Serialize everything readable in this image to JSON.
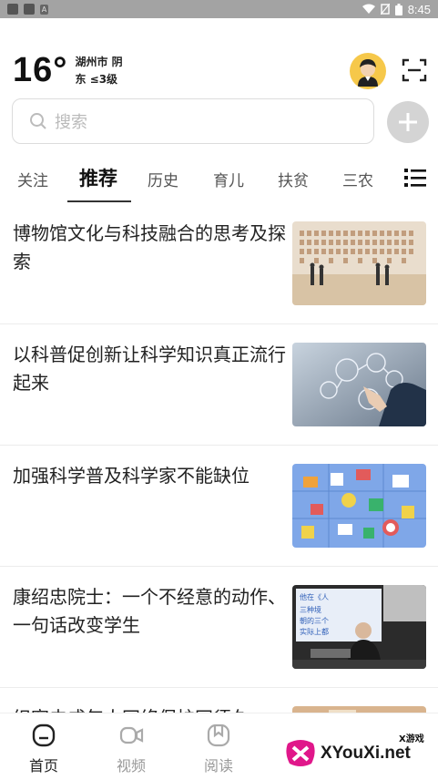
{
  "status_bar": {
    "time": "8:45",
    "notif_badge": "A"
  },
  "weather": {
    "temperature": "16°",
    "city_condition": "湖州市 阴",
    "wind": "东 ≤3级"
  },
  "search": {
    "placeholder": "搜索"
  },
  "tabs": [
    {
      "label": "关注"
    },
    {
      "label": "推荐",
      "active": true
    },
    {
      "label": "历史"
    },
    {
      "label": "育儿"
    },
    {
      "label": "扶贫"
    },
    {
      "label": "三农"
    }
  ],
  "news": [
    {
      "title": "博物馆文化与科技融合的思考及探索",
      "thumb": "museum-gallery"
    },
    {
      "title": "以科普促创新让科学知识真正流行起来",
      "thumb": "touch-interface"
    },
    {
      "title": "加强科学普及科学家不能缺位",
      "thumb": "isometric-icons"
    },
    {
      "title": "康绍忠院士：一个不经意的动作、一句话改变学生",
      "thumb": "lecture-speaker",
      "thumb_text": "他在《人… 三种境 …朝的三个 …实际上都 … 追求"
    },
    {
      "title": "织密未成年人网络保护网须久",
      "thumb": "partial"
    }
  ],
  "bottom_nav": [
    {
      "label": "首页",
      "icon": "home-icon",
      "active": true
    },
    {
      "label": "视频",
      "icon": "video-icon"
    },
    {
      "label": "阅读",
      "icon": "read-icon"
    }
  ],
  "watermark": {
    "text": "XYouXi.net",
    "small": "X游戏"
  },
  "colors": {
    "accent": "#222222",
    "muted": "#999999",
    "divider": "#ececec",
    "avatar_bg": "#f6c84a"
  }
}
